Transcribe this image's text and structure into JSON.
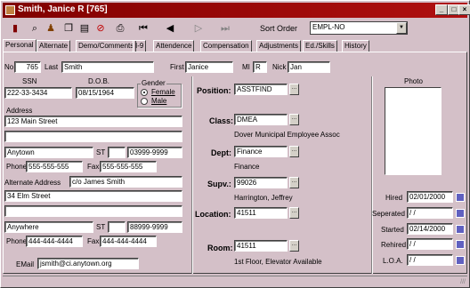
{
  "window": {
    "title": "Smith, Janice R [765]"
  },
  "toolbar": {
    "sort_label": "Sort Order",
    "sort_value": "EMPL-NO"
  },
  "tabs": [
    "Personal",
    "Alternate",
    "Demo/Comments",
    "I-9",
    "Attendence",
    "Compensation",
    "Adjustments",
    "Ed./Skills",
    "History"
  ],
  "person": {
    "no_label": "No",
    "no": "765",
    "last_label": "Last",
    "last": "Smith",
    "first_label": "First",
    "first": "Janice",
    "mi_label": "MI",
    "mi": "R",
    "nick_label": "Nick",
    "nick": "Jan",
    "ssn_label": "SSN",
    "ssn": "222-33-3434",
    "dob_label": "D.O.B.",
    "dob": "08/15/1964",
    "gender_label": "Gender",
    "gender_female": "Female",
    "gender_male": "Male",
    "gender_selected": "Female",
    "address_label": "Address",
    "address1": "123 Main Street",
    "address2": "",
    "city": "Anytown",
    "st_label": "ST",
    "state": "",
    "zip": "03999-9999",
    "phone_label": "Phone",
    "phone": "555-555-555",
    "fax_label": "Fax",
    "fax": "555-555-555",
    "alt_address_label": "Alternate Address",
    "alt_address_care": "c/o James Smith",
    "alt_address1": "34 Elm Street",
    "alt_address2": "",
    "alt_city": "Anywhere",
    "alt_state": "",
    "alt_zip": "88999-9999",
    "alt_phone": "444-444-4444",
    "alt_fax": "444-444-4444",
    "email_label": "EMail",
    "email": "jsmith@ci.anytown.org"
  },
  "job": {
    "position_label": "Position:",
    "position": "ASSTFIND",
    "class_label": "Class:",
    "class": "DMEA",
    "class_desc": "Dover Municipal Employee Assoc",
    "dept_label": "Dept:",
    "dept": "Finance",
    "dept_desc": "Finance",
    "supv_label": "Supv.:",
    "supv": "99026",
    "supv_desc": "Harrington, Jeffrey",
    "location_label": "Location:",
    "location": "41511",
    "room_label": "Room:",
    "room": "41511",
    "room_desc": "1st Floor, Elevator Available"
  },
  "photo_label": "Photo",
  "dates": {
    "hired_label": "Hired",
    "hired": "02/01/2000",
    "separated_label": "Seperated",
    "separated": "/ /",
    "started_label": "Started",
    "started": "02/14/2000",
    "rehired_label": "Rehired",
    "rehired": "/ /",
    "loa_label": "L.O.A.",
    "loa": "/ /"
  },
  "icons": [
    "save-icon",
    "search-icon",
    "person-icon",
    "copy-icon",
    "new-icon",
    "stop-icon",
    "print-icon",
    "first-record-icon",
    "prev-record-icon",
    "next-record-icon",
    "last-record-icon"
  ]
}
